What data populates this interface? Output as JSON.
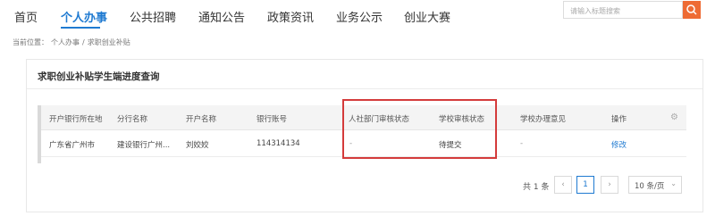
{
  "nav": {
    "items": [
      "首页",
      "个人办事",
      "公共招聘",
      "通知公告",
      "政策资讯",
      "业务公示",
      "创业大赛"
    ],
    "active_index": 1
  },
  "search": {
    "placeholder": "请输入标题搜索"
  },
  "breadcrumb": {
    "prefix": "当前位置：",
    "path": [
      "个人办事",
      "/",
      "求职创业补贴"
    ]
  },
  "card": {
    "title": "求职创业补贴学生端进度查询"
  },
  "table": {
    "headers": [
      "开户银行所在地",
      "分行名称",
      "开户名称",
      "银行账号",
      "人社部门审核状态",
      "学校审核状态",
      "学校办理意见",
      "操作"
    ],
    "rows": [
      [
        "广东省广州市",
        "建设银行广州...",
        "刘姣姣",
        "114314134",
        "-",
        "待提交",
        "-",
        "修改"
      ]
    ]
  },
  "pager": {
    "total": "共 1 条",
    "prev": "‹",
    "current": "1",
    "next": "›",
    "page_size": "10 条/页"
  },
  "colors": {
    "accent": "#1f7ad1",
    "search_button": "#ee6b34",
    "highlight_box": "#d43b3b"
  }
}
